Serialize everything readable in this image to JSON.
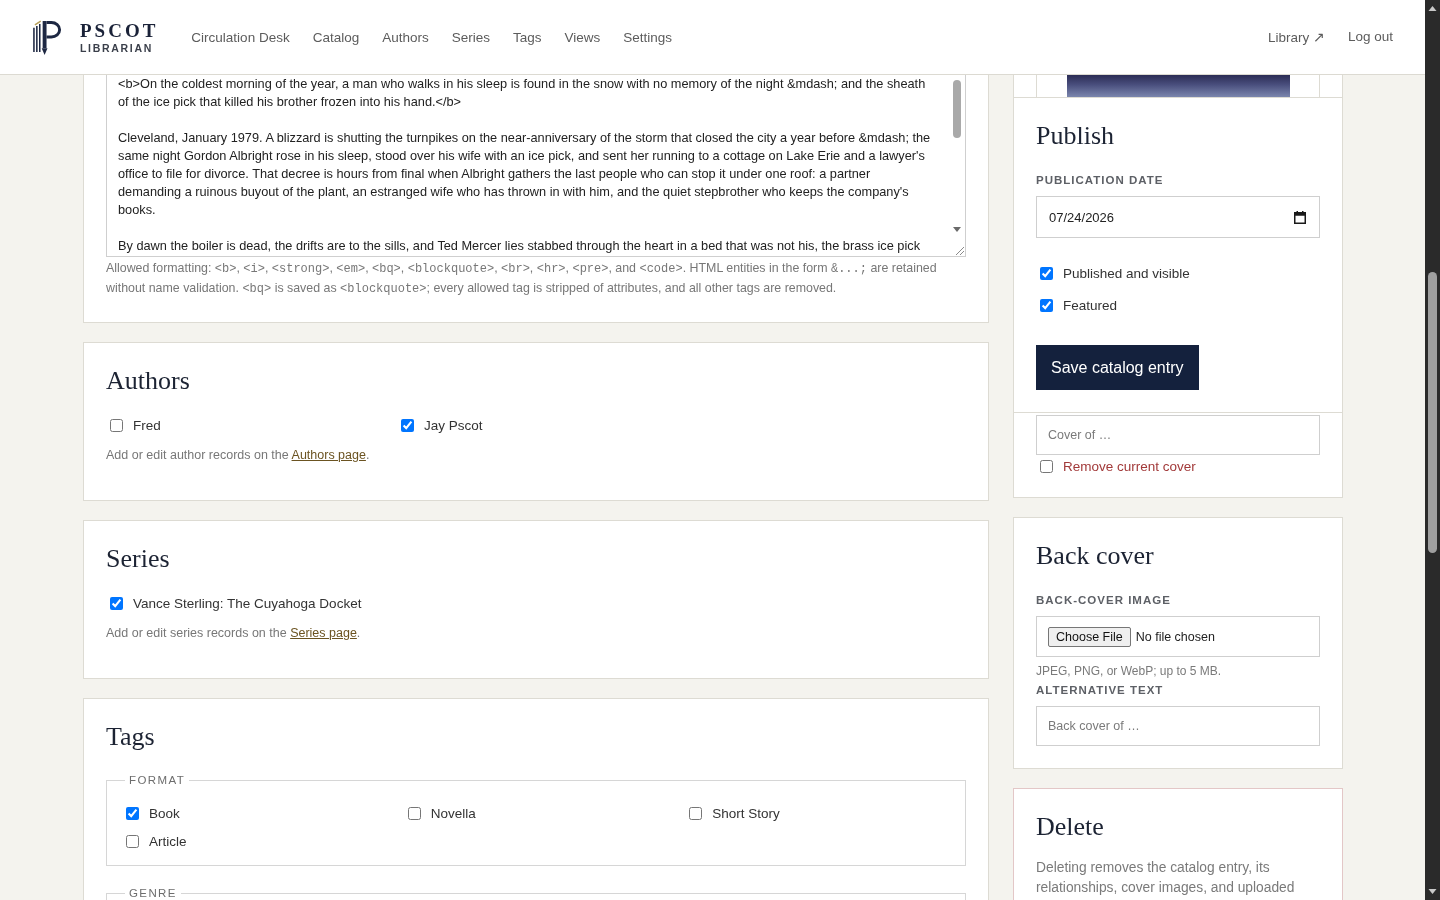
{
  "header": {
    "brand": {
      "name": "PSCOT",
      "subtitle": "LIBRARIAN"
    },
    "nav": [
      {
        "label": "Circulation Desk"
      },
      {
        "label": "Catalog"
      },
      {
        "label": "Authors"
      },
      {
        "label": "Series"
      },
      {
        "label": "Tags"
      },
      {
        "label": "Views"
      },
      {
        "label": "Settings"
      }
    ],
    "right_links": [
      "Library ↗",
      "Log out"
    ]
  },
  "description": {
    "value": "<b>On the coldest morning of the year, a man who walks in his sleep is found in the snow with no memory of the night &mdash; and the sheath of the ice pick that killed his brother frozen into his hand.</b>\n\nCleveland, January 1979. A blizzard is shutting the turnpikes on the near-anniversary of the storm that closed the city a year before &mdash; the same night Gordon Albright rose in his sleep, stood over his wife with an ice pick, and sent her running to a cottage on Lake Erie and a lawyer's office to file for divorce. That decree is hours from final when Albright gathers the last people who can stop it under one roof: a partner demanding a ruinous buyout of the plant, an estranged wife who has thrown in with him, and the quiet stepbrother who keeps the company's books.\n\nBy dawn the boiler is dead, the drifts are to the sills, and Ted Mercer lies stabbed through the heart in a bed that was not his, the brass ice pick",
    "help": [
      {
        "kind": "text",
        "text": "Allowed formatting: "
      },
      {
        "kind": "code",
        "text": "<b>"
      },
      {
        "kind": "text",
        "text": ", "
      },
      {
        "kind": "code",
        "text": "<i>"
      },
      {
        "kind": "text",
        "text": ", "
      },
      {
        "kind": "code",
        "text": "<strong>"
      },
      {
        "kind": "text",
        "text": ", "
      },
      {
        "kind": "code",
        "text": "<em>"
      },
      {
        "kind": "text",
        "text": ", "
      },
      {
        "kind": "code",
        "text": "<bq>"
      },
      {
        "kind": "text",
        "text": ", "
      },
      {
        "kind": "code",
        "text": "<blockquote>"
      },
      {
        "kind": "text",
        "text": ", "
      },
      {
        "kind": "code",
        "text": "<br>"
      },
      {
        "kind": "text",
        "text": ", "
      },
      {
        "kind": "code",
        "text": "<hr>"
      },
      {
        "kind": "text",
        "text": ", "
      },
      {
        "kind": "code",
        "text": "<pre>"
      },
      {
        "kind": "text",
        "text": ", and "
      },
      {
        "kind": "code",
        "text": "<code>"
      },
      {
        "kind": "text",
        "text": ". HTML entities in the form "
      },
      {
        "kind": "code",
        "text": "&...;"
      },
      {
        "kind": "text",
        "text": " are retained without name validation. "
      },
      {
        "kind": "code",
        "text": "<bq>"
      },
      {
        "kind": "text",
        "text": " is saved as "
      },
      {
        "kind": "code",
        "text": "<blockquote>"
      },
      {
        "kind": "text",
        "text": "; every allowed tag is stripped of attributes, and all other tags are removed."
      }
    ]
  },
  "authors": {
    "title": "Authors",
    "options": [
      {
        "label": "Fred",
        "checked": false
      },
      {
        "label": "Jay Pscot",
        "checked": true
      }
    ],
    "hint": {
      "before": "Add or edit author records on the ",
      "link": "Authors page",
      "after": "."
    }
  },
  "series": {
    "title": "Series",
    "options": [
      {
        "label": "Vance Sterling: The Cuyahoga Docket",
        "checked": true
      }
    ],
    "hint": {
      "before": "Add or edit series records on the ",
      "link": "Series page",
      "after": "."
    }
  },
  "tags": {
    "title": "Tags",
    "groups": [
      {
        "legend": "FORMAT",
        "options": [
          {
            "label": "Book",
            "checked": true
          },
          {
            "label": "Novella",
            "checked": false
          },
          {
            "label": "Short Story",
            "checked": false
          },
          {
            "label": "Article",
            "checked": false
          }
        ]
      },
      {
        "legend": "GENRE"
      }
    ]
  },
  "publish": {
    "title": "Publish",
    "date_label": "PUBLICATION DATE",
    "date_value": "07/24/2026",
    "options": [
      {
        "label": "Published and visible",
        "checked": true
      },
      {
        "label": "Featured",
        "checked": true
      }
    ],
    "save_button": "Save catalog entry"
  },
  "cover": {
    "alt_placeholder": "Cover of …",
    "remove": {
      "label": "Remove current cover",
      "checked": false
    }
  },
  "back_cover": {
    "title": "Back cover",
    "image_label": "BACK-COVER IMAGE",
    "file_button": "Choose File",
    "file_status": "No file chosen",
    "hint": "JPEG, PNG, or WebP; up to 5 MB.",
    "alt_label": "ALTERNATIVE TEXT",
    "alt_placeholder": "Back cover of …"
  },
  "delete": {
    "title": "Delete",
    "text": "Deleting removes the catalog entry, its relationships, cover images, and uploaded"
  }
}
